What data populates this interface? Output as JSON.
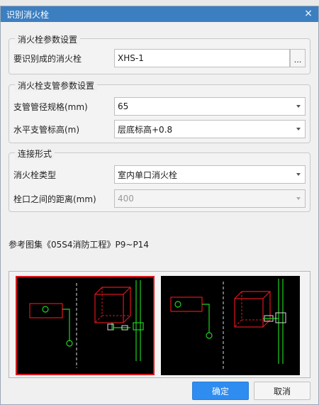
{
  "window": {
    "title": "识别消火栓",
    "close_glyph": "×"
  },
  "group_params": {
    "legend": "消火栓参数设置",
    "hydrant_label": "要识别成的消火栓",
    "hydrant_value": "XHS-1",
    "browse_glyph": "..."
  },
  "group_branch": {
    "legend": "消火栓支管参数设置",
    "pipe_size_label": "支管管径规格(mm)",
    "pipe_size_value": "65",
    "elevation_label": "水平支管标高(m)",
    "elevation_value": "层底标高+0.8"
  },
  "group_connect": {
    "legend": "连接形式",
    "type_label": "消火栓类型",
    "type_value": "室内单口消火栓",
    "distance_label": "栓口之间的距离(mm)",
    "distance_value": "400"
  },
  "reference_text": "参考图集《05S4消防工程》P9~P14",
  "buttons": {
    "ok": "确定",
    "cancel": "取消"
  },
  "colors": {
    "accent": "#3c7fc1",
    "ok_button": "#2f8cf0",
    "selected_preview_border": "#e0151b"
  }
}
